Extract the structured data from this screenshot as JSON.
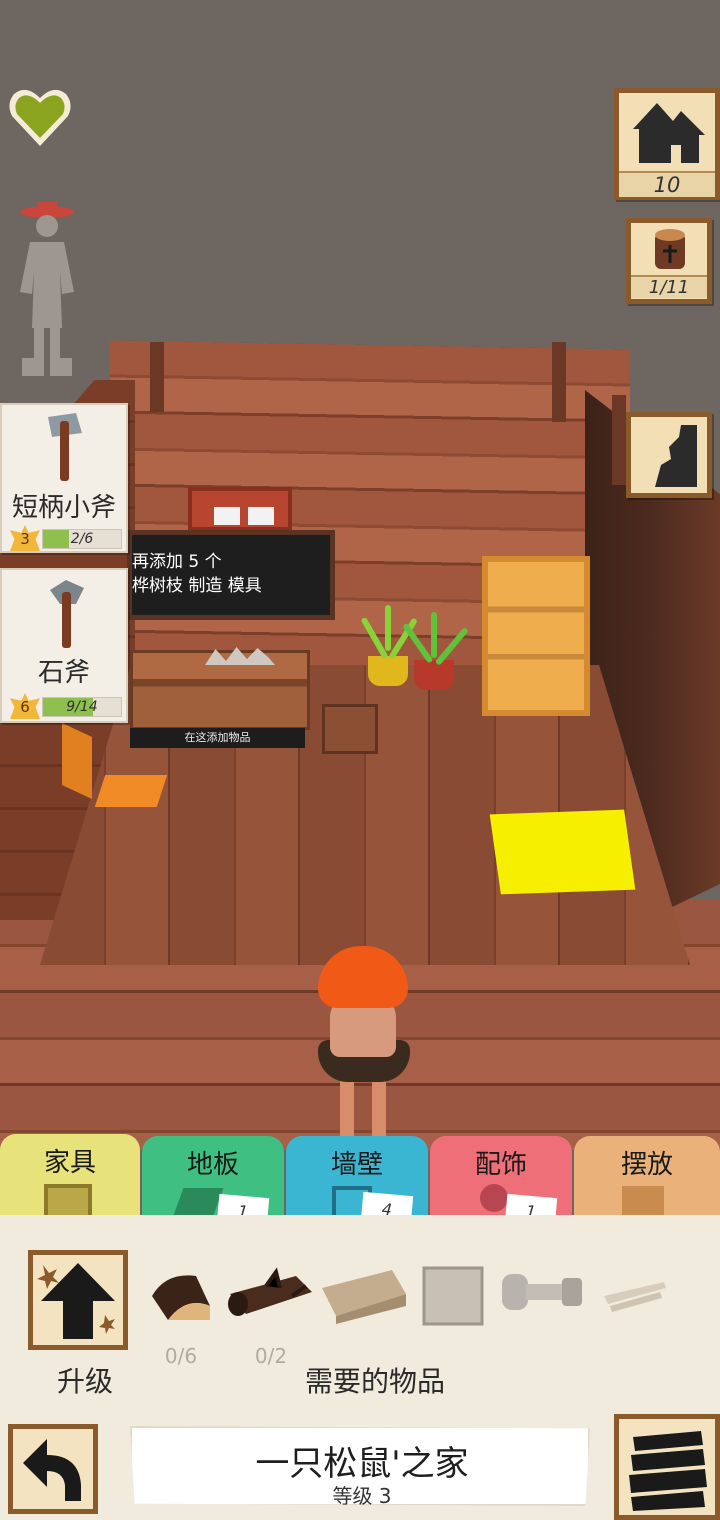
{
  "hud": {
    "health_icon": "heart-icon",
    "health_color": "#8aa420",
    "character_icon": "character-silhouette-icon"
  },
  "tools": [
    {
      "name": "短柄小斧",
      "level": "3",
      "progress_text": "2/6",
      "progress": 0.333,
      "icon": "hatchet-icon"
    },
    {
      "name": "石斧",
      "level": "6",
      "progress_text": "9/14",
      "progress": 0.643,
      "icon": "stone-axe-icon"
    }
  ],
  "right_buttons": {
    "homes": {
      "icon": "house-icon",
      "count": "10"
    },
    "logs": {
      "icon": "log-icon",
      "count": "1/11"
    },
    "map": {
      "icon": "map-icon"
    }
  },
  "scene": {
    "board_line1": "再添加 5 个",
    "board_line2": "桦树枝 制造 模具",
    "bench_label": "在这添加物品",
    "rug_color": "#f7ef00"
  },
  "tabs": [
    {
      "label": "家具",
      "count": "",
      "color": "#e8e27a"
    },
    {
      "label": "地板",
      "count": "1",
      "color": "#3fbf82"
    },
    {
      "label": "墙壁",
      "count": "4",
      "color": "#3ab6d3"
    },
    {
      "label": "配饰",
      "count": "1",
      "color": "#ef6f78"
    },
    {
      "label": "摆放",
      "count": "",
      "color": "#eab27a"
    }
  ],
  "panel": {
    "upgrade_label": "升级",
    "required_label": "需要的物品",
    "items": [
      {
        "icon": "bark-icon",
        "count": "0/6"
      },
      {
        "icon": "log-pile-icon",
        "count": "0/2"
      },
      {
        "icon": "planks-icon",
        "count": ""
      },
      {
        "icon": "stone-tile-icon",
        "count": ""
      },
      {
        "icon": "bolt-icon",
        "count": ""
      },
      {
        "icon": "sticks-icon",
        "count": ""
      }
    ]
  },
  "footer": {
    "home_name": "一只松鼠'之家",
    "home_level": "等级 3",
    "back_icon": "back-arrow-icon",
    "menu_icon": "layers-icon"
  }
}
